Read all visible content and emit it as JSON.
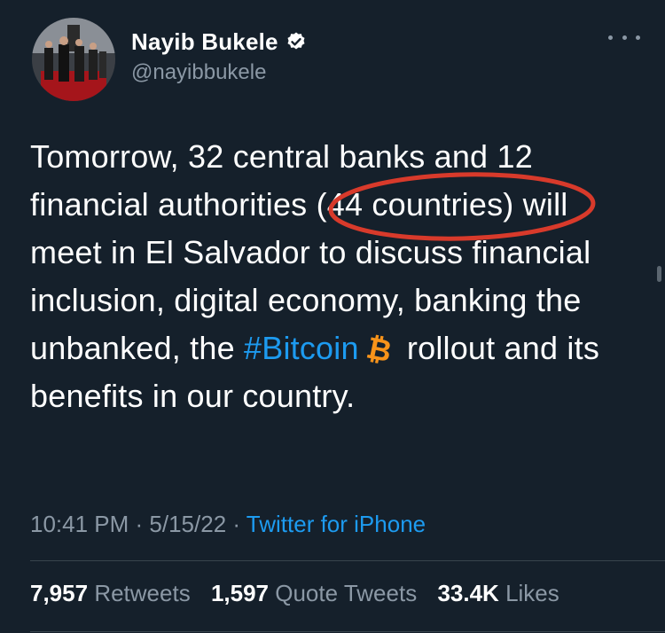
{
  "user": {
    "display_name": "Nayib Bukele",
    "handle": "@nayibbukele",
    "verified": true
  },
  "tweet": {
    "text_1": "Tomorrow, 32 central banks and 12 financial authorities (44 countries) will meet in El Salvador to discuss financial inclusion, digital economy, banking the unbanked, the",
    "hashtag": "#Bitcoin",
    "emoji": "bitcoin-emoji",
    "text_2": " rollout and its benefits in our country.",
    "highlighted_phrase": "(44 countries)"
  },
  "meta": {
    "time": "10:41 PM",
    "separator": " · ",
    "date": "5/15/22",
    "source": "Twitter for iPhone"
  },
  "stats": {
    "retweets_count": "7,957",
    "retweets_label": "Retweets",
    "quotes_count": "1,597",
    "quotes_label": "Quote Tweets",
    "likes_count": "33.4K",
    "likes_label": "Likes"
  },
  "colors": {
    "background": "#15202b",
    "accent": "#1d9bf0",
    "annotation_red": "#d83a2b",
    "bitcoin_orange": "#f7931a"
  }
}
